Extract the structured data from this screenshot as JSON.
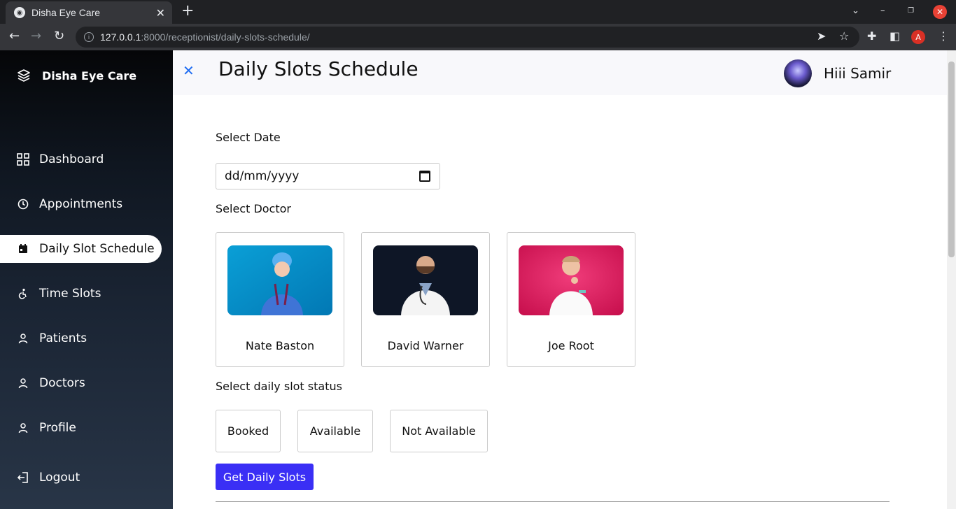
{
  "browser": {
    "tab_title": "Disha Eye Care",
    "url_host": "127.0.0.1",
    "url_path": ":8000/receptionist/daily-slots-schedule/",
    "profile_initial": "A"
  },
  "sidebar": {
    "brand": "Disha Eye Care",
    "items": [
      {
        "label": "Dashboard",
        "icon": "grid-icon"
      },
      {
        "label": "Appointments",
        "icon": "clock-icon"
      },
      {
        "label": "Daily Slot Schedule",
        "icon": "calendar-icon",
        "active": true
      },
      {
        "label": "Time Slots",
        "icon": "accessibility-icon"
      },
      {
        "label": "Patients",
        "icon": "user-icon"
      },
      {
        "label": "Doctors",
        "icon": "user-icon"
      },
      {
        "label": "Profile",
        "icon": "user-icon"
      },
      {
        "label": "Logout",
        "icon": "logout-icon"
      }
    ]
  },
  "header": {
    "title": "Daily Slots Schedule",
    "greeting": "Hiii Samir"
  },
  "form": {
    "date_label": "Select Date",
    "date_placeholder": "dd/mm/yyyy",
    "doctor_label": "Select Doctor",
    "doctors": [
      {
        "name": "Nate Baston"
      },
      {
        "name": "David Warner"
      },
      {
        "name": "Joe Root"
      }
    ],
    "status_label": "Select daily slot status",
    "statuses": [
      "Booked",
      "Available",
      "Not Available"
    ],
    "submit_label": "Get Daily Slots"
  },
  "colors": {
    "accent": "#3a2ff5",
    "close_icon": "#1e6cf2"
  }
}
